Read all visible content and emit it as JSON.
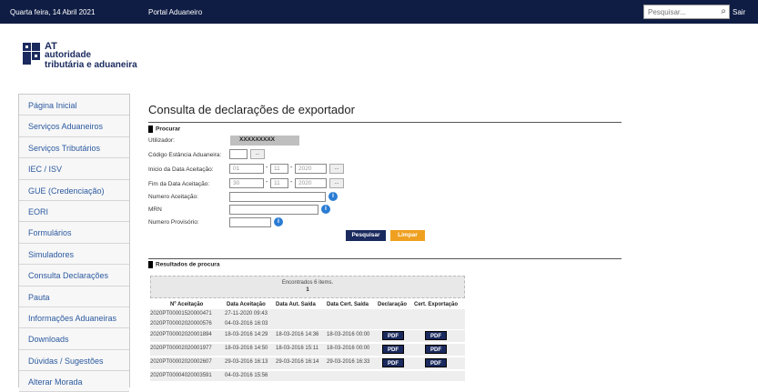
{
  "topbar": {
    "date": "Quarta feira, 14 Abril 2021",
    "portal": "Portal Aduaneiro",
    "search_placeholder": "Pesquisar...",
    "exit": "Sair"
  },
  "logo": {
    "line1": "AT",
    "line2": "autoridade",
    "line3": "tributária e aduaneira"
  },
  "sidebar": {
    "items": [
      "Página Inicial",
      "Serviços Aduaneiros",
      "Serviços Tributários",
      "IEC / ISV",
      "GUE (Credenciação)",
      "EORI",
      "Formulários",
      "Simuladores",
      "Consulta Declarações",
      "Pauta",
      "Informações Aduaneiras",
      "Downloads",
      "Dúvidas / Sugestões",
      "Alterar Morada"
    ]
  },
  "page": {
    "title": "Consulta de declarações de exportador"
  },
  "search": {
    "heading": "Procurar",
    "user_label": "Utilizador:",
    "user_value": "XXXXXXXXX",
    "customs_label": "Código Estância Aduaneira:",
    "start_label": "Inicio da Data Aceitação:",
    "start_day": "01",
    "start_month": "11",
    "start_year": "2020",
    "end_label": "Fim da Data Aceitação:",
    "end_day": "30",
    "end_month": "11",
    "end_year": "2020",
    "acceptance_label": "Numero Aceitação:",
    "mrn_label": "MRN",
    "provisional_label": "Numero Provisório:",
    "ellipsis": "...",
    "dash": "-",
    "info": "i",
    "search_button": "Pesquisar",
    "clear_button": "Limpar"
  },
  "results": {
    "heading": "Resultados de procura",
    "found": "Encontrados 6 items.",
    "page": "1",
    "columns": [
      "Nº Aceitação",
      "Data Aceitação",
      "Data Aut. Saída",
      "Data Cert. Saída",
      "Declaração",
      "Cert. Exportação"
    ],
    "pdf": "PDF",
    "rows": [
      {
        "num": "2020PT00001520000471",
        "acc": "27-11-2020 09:43",
        "aut": "",
        "cert": "",
        "pdf": false
      },
      {
        "num": "2020PT00002020000576",
        "acc": "04-03-2016 16:03",
        "aut": "",
        "cert": "",
        "pdf": false
      },
      {
        "num": "2020PT00002020001894",
        "acc": "18-03-2016 14:29",
        "aut": "18-03-2016 14:36",
        "cert": "18-03-2016 00:00",
        "pdf": true
      },
      {
        "num": "2020PT00002020001977",
        "acc": "18-03-2016 14:50",
        "aut": "18-03-2016 15:11",
        "cert": "18-03-2016 00:00",
        "pdf": true
      },
      {
        "num": "2020PT00002020002607",
        "acc": "29-03-2016 16:13",
        "aut": "29-03-2016 16:14",
        "cert": "29-03-2016 16:33",
        "pdf": true
      },
      {
        "num": "2020PT00004020003591",
        "acc": "04-03-2016 15:56",
        "aut": "",
        "cert": "",
        "pdf": false
      }
    ]
  }
}
